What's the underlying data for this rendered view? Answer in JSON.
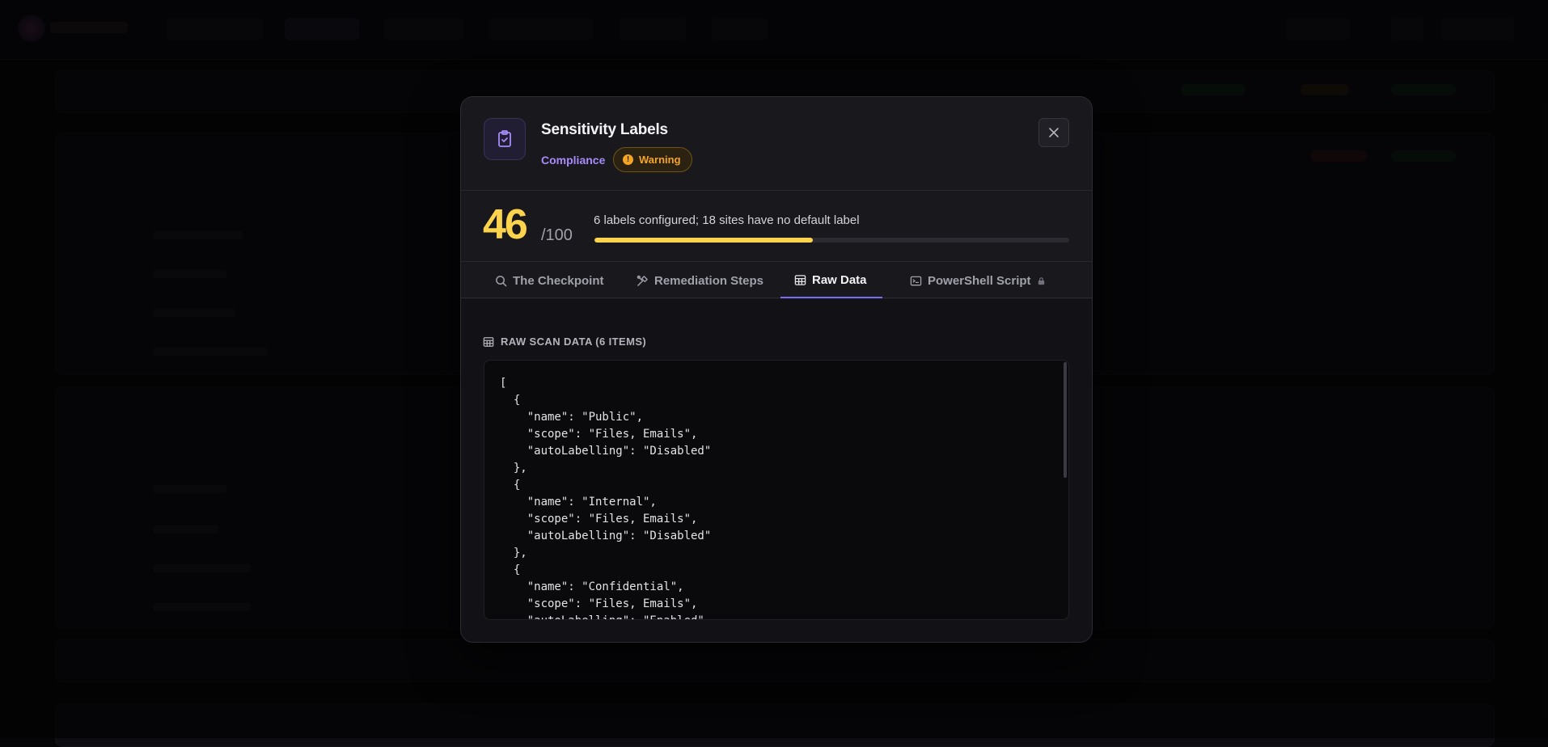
{
  "modal": {
    "title": "Sensitivity Labels",
    "category": "Compliance",
    "status": "Warning",
    "status_icon": "!",
    "icon": "clipboard-check-icon",
    "close_icon": "close-icon"
  },
  "score": {
    "value": "46",
    "max": "/100",
    "summary": "6 labels configured; 18 sites have no default label",
    "progress": 0.46
  },
  "tabs": [
    {
      "label": "The Checkpoint",
      "icon": "search-icon",
      "active": false
    },
    {
      "label": "Remediation Steps",
      "icon": "tools-icon",
      "active": false
    },
    {
      "label": "Raw Data",
      "icon": "table-icon",
      "active": true
    },
    {
      "label": "PowerShell Script",
      "icon": "terminal-icon",
      "locked": true,
      "active": false
    }
  ],
  "raw": {
    "heading": "RAW SCAN DATA (6 ITEMS)",
    "lines": [
      "[",
      "  {",
      "    \"name\": \"Public\",",
      "    \"scope\": \"Files, Emails\",",
      "    \"autoLabelling\": \"Disabled\"",
      "  },",
      "  {",
      "    \"name\": \"Internal\",",
      "    \"scope\": \"Files, Emails\",",
      "    \"autoLabelling\": \"Disabled\"",
      "  },",
      "  {",
      "    \"name\": \"Confidential\",",
      "    \"scope\": \"Files, Emails\",",
      "    \"autoLabelling\": \"Enabled\""
    ]
  },
  "colors": {
    "accent": "#7c6cf0",
    "warning": "#f5a524",
    "score": "#fcd34d",
    "category": "#a78bfa"
  }
}
